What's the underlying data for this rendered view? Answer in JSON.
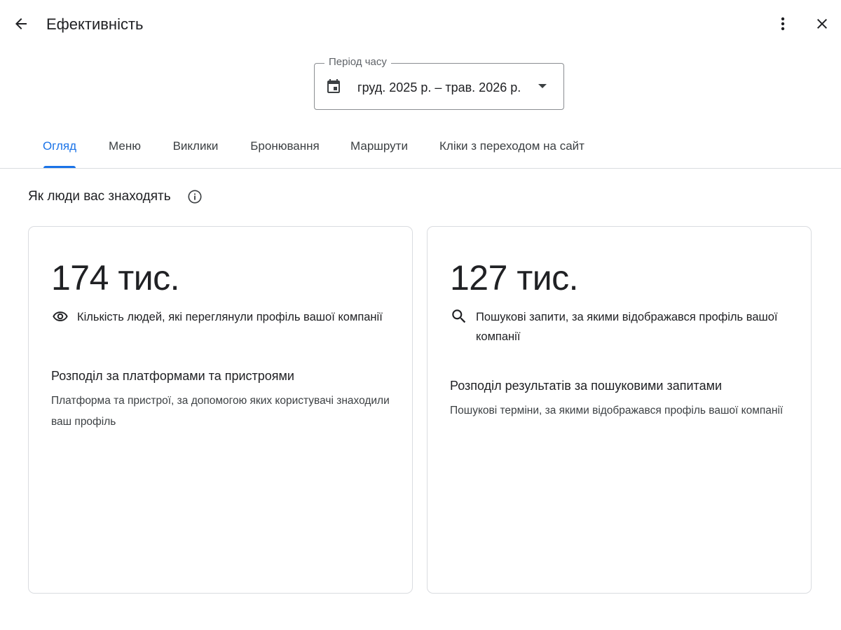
{
  "header": {
    "title": "Ефективність",
    "back_icon": "arrow-back-icon",
    "more_icon": "more-vert-icon",
    "close_icon": "close-icon"
  },
  "period": {
    "label": "Період часу",
    "value": "груд. 2025 р. – трав. 2026 р.",
    "calendar_icon": "calendar-icon",
    "dropdown_icon": "arrow-drop-down-icon"
  },
  "tabs": [
    {
      "label": "Огляд",
      "active": true
    },
    {
      "label": "Меню",
      "active": false
    },
    {
      "label": "Виклики",
      "active": false
    },
    {
      "label": "Бронювання",
      "active": false
    },
    {
      "label": "Маршрути",
      "active": false
    },
    {
      "label": "Кліки з переходом на сайт",
      "active": false
    }
  ],
  "section": {
    "title": "Як люди вас знаходять",
    "info_icon": "info-icon"
  },
  "cards": [
    {
      "value": "174 тис.",
      "icon": "eye-icon",
      "description": "Кількість людей, які переглянули профіль вашої компанії",
      "breakdown_title": "Розподіл за платформами та пристроями",
      "breakdown_text": "Платформа та пристрої, за допомогою яких користувачі знаходили ваш профіль"
    },
    {
      "value": "127 тис.",
      "icon": "search-icon",
      "description": "Пошукові запити, за якими відображався профіль вашої компанії",
      "breakdown_title": "Розподіл результатів за пошуковими запитами",
      "breakdown_text": "Пошукові терміни, за якими відображався профіль вашої компанії"
    }
  ],
  "colors": {
    "accent": "#1a73e8",
    "text": "#202124",
    "secondary_text": "#3c4043",
    "border": "#dadce0"
  }
}
